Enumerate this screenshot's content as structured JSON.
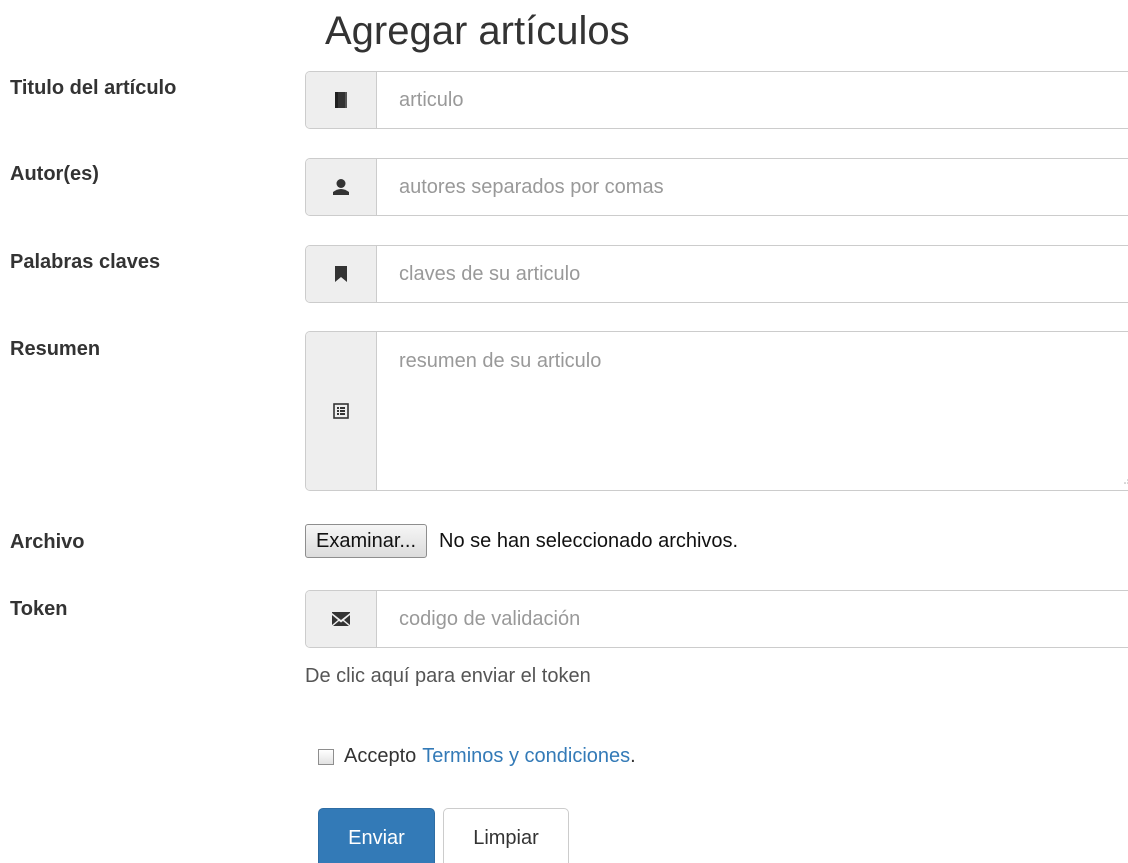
{
  "page": {
    "title": "Agregar artículos"
  },
  "form": {
    "article_title": {
      "label": "Titulo del artículo",
      "icon": "book-icon",
      "placeholder": "articulo",
      "value": ""
    },
    "authors": {
      "label": "Autor(es)",
      "icon": "user-icon",
      "placeholder": "autores separados por comas",
      "value": ""
    },
    "keywords": {
      "label": "Palabras claves",
      "icon": "bookmark-icon",
      "placeholder": "claves de su articulo",
      "value": ""
    },
    "summary": {
      "label": "Resumen",
      "icon": "list-alt-icon",
      "placeholder": "resumen de su articulo",
      "value": ""
    },
    "file": {
      "label": "Archivo",
      "button_label": "Examinar...",
      "status": "No se han seleccionado archivos."
    },
    "token": {
      "label": "Token",
      "icon": "envelope-icon",
      "placeholder": "codigo de validación",
      "value": "",
      "help_text": "De clic aquí para enviar el token"
    },
    "terms": {
      "prefix": "Accepto",
      "link_text": "Terminos y condiciones",
      "suffix": ".",
      "checked": false
    },
    "actions": {
      "submit_label": "Enviar",
      "reset_label": "Limpiar"
    }
  },
  "colors": {
    "primary": "#337ab7",
    "addon_background": "#eeeeee",
    "border": "#cccccc",
    "placeholder": "#999999"
  }
}
